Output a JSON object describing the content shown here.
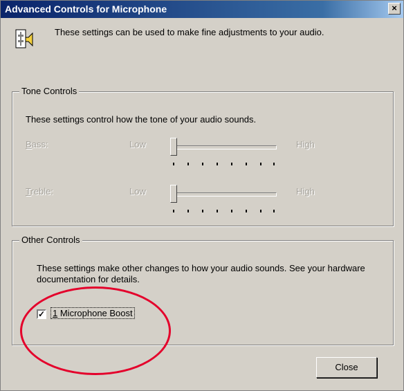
{
  "window": {
    "title": "Advanced Controls for Microphone",
    "close_glyph": "×"
  },
  "intro": {
    "icon": "speaker-settings-icon",
    "text": "These settings can be used to make fine adjustments to your audio."
  },
  "tone_controls": {
    "legend": "Tone Controls",
    "description": "These settings control how the tone of your audio sounds.",
    "bass": {
      "label": "Bass:",
      "mnemonic": "B",
      "rest": "ass:",
      "low": "Low",
      "high": "High",
      "value": 0,
      "enabled": false
    },
    "treble": {
      "label": "Treble:",
      "mnemonic": "T",
      "rest": "reble:",
      "low": "Low",
      "high": "High",
      "value": 0,
      "enabled": false
    }
  },
  "other_controls": {
    "legend": "Other Controls",
    "description": "These settings make other changes to how your audio sounds. See your hardware documentation for details.",
    "checkbox": {
      "checked": true,
      "mnemonic": "1",
      "rest": " Microphone Boost",
      "check_glyph": "✓"
    }
  },
  "buttons": {
    "close": "Close"
  },
  "colors": {
    "titlebar": "#0a246a",
    "annotation": "#e4002b",
    "face": "#d4d0c8"
  }
}
